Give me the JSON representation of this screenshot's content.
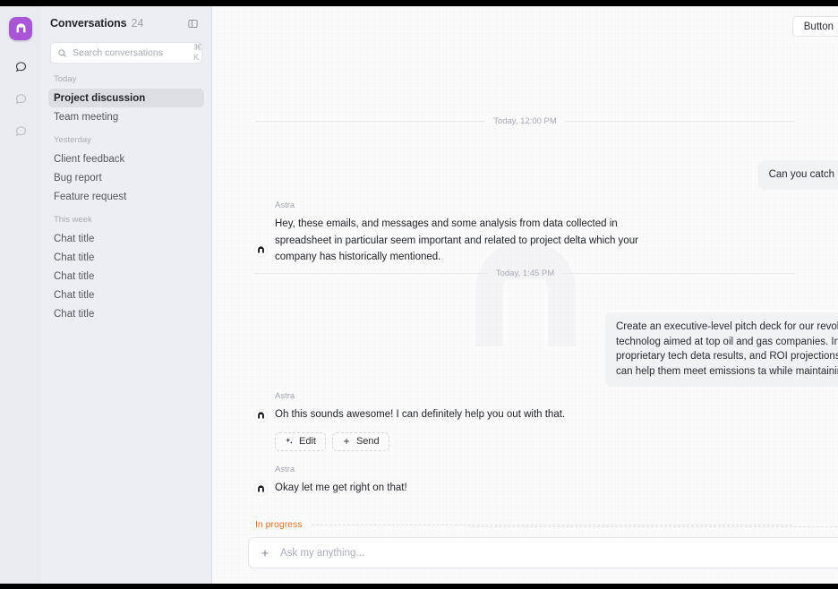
{
  "rail": {
    "logo_name": "astra-logo",
    "items": [
      {
        "icon": "chat-bubble-icon",
        "state": "active"
      },
      {
        "icon": "chat-bubble-icon",
        "state": "idle"
      },
      {
        "icon": "chat-bubble-icon",
        "state": "idle"
      }
    ]
  },
  "sidebar": {
    "title": "Conversations",
    "count": "24",
    "panel_toggle_icon": "panel-toggle-icon",
    "search": {
      "placeholder": "Search conversations",
      "value": "",
      "shortcut": "⌘ K",
      "icon": "search-icon"
    },
    "groups": [
      {
        "label": "Today",
        "items": [
          {
            "label": "Project discussion",
            "active": true
          },
          {
            "label": "Team meeting",
            "active": false
          }
        ]
      },
      {
        "label": "Yesterday",
        "items": [
          {
            "label": "Client feedback",
            "active": false
          },
          {
            "label": "Bug report",
            "active": false
          },
          {
            "label": "Feature request",
            "active": false
          }
        ]
      },
      {
        "label": "This week",
        "items": [
          {
            "label": "Chat title",
            "active": false
          },
          {
            "label": "Chat title",
            "active": false
          },
          {
            "label": "Chat title",
            "active": false
          },
          {
            "label": "Chat title",
            "active": false
          },
          {
            "label": "Chat title",
            "active": false
          }
        ]
      }
    ]
  },
  "main": {
    "top_button": "Button",
    "dividers": {
      "first": "Today, 12:00 PM",
      "second": "Today, 1:45 PM"
    },
    "messages": [
      {
        "role": "user",
        "text": "Can you catch me up since I've be"
      },
      {
        "role": "assistant",
        "author": "Astra",
        "text": "Hey, these emails, and messages and some analysis from data collected in spreadsheet in particular seem important and related to project delta which your company has historically mentioned."
      },
      {
        "role": "user",
        "text": "Create an executive-level pitch deck for our revolutionary carbon capture technolog aimed at top oil and gas companies. Include market potential, proprietary tech deta results, and ROI projections, emphasizing how we can help them meet emissions ta while maintaining profitability."
      },
      {
        "role": "assistant",
        "author": "Astra",
        "text": "Oh this sounds awesome! I can definitely help you out with that."
      },
      {
        "role": "assistant",
        "author": "Astra",
        "text": "Okay let me get right on that!"
      }
    ],
    "actions": [
      {
        "label": "Edit",
        "icon": "sparkle-icon"
      },
      {
        "label": "Send",
        "icon": "plus-icon"
      }
    ],
    "status": {
      "label": "In progress",
      "color": "#e8762a"
    },
    "composer": {
      "placeholder": "Ask my anything...",
      "value": "",
      "add_icon": "plus-icon"
    }
  },
  "colors": {
    "brand_purple": "#a855d6",
    "status_orange": "#e8762a",
    "sidebar_bg": "#eceef2",
    "main_bg": "#fbfbfc",
    "bubble_bg": "#f1f2f4"
  }
}
